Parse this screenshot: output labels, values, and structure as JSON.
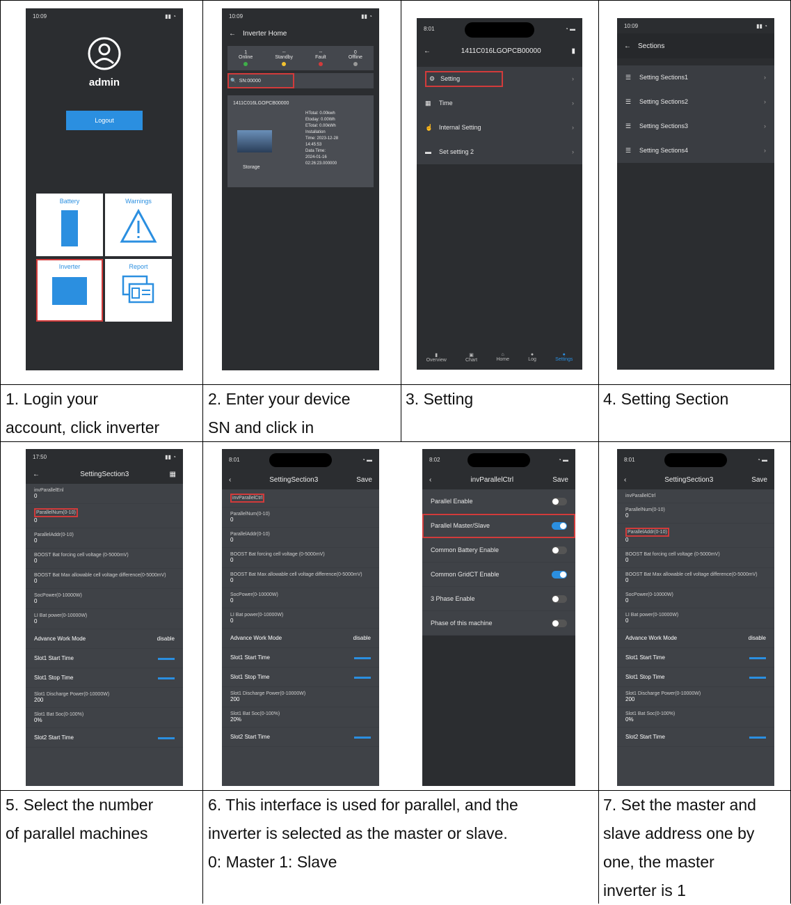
{
  "captions": {
    "c1": "1. Login your\naccount, click inverter",
    "c2": "2. Enter your device\nSN and click in",
    "c3": "3. Setting",
    "c4": "4. Setting Section",
    "c5": "5. Select the number\nof parallel machines",
    "c6": "6. This interface is used for parallel, and the\ninverter is selected as the master or slave.\n0: Master 1: Slave",
    "c7": "7. Set the master and\nslave address one by\none, the master\ninverter is 1"
  },
  "s1": {
    "status": "10:09",
    "user": "admin",
    "logout": "Logout",
    "tiles": [
      "Battery",
      "Warnings",
      "Inverter",
      "Report"
    ]
  },
  "s2": {
    "status": "10:09",
    "title": "Inverter Home",
    "counts": [
      {
        "label": "Online",
        "value": "1",
        "color": "#3fae49"
      },
      {
        "label": "Standby",
        "value": "--",
        "color": "#f2c230"
      },
      {
        "label": "Fault",
        "value": "--",
        "color": "#d23b3b"
      },
      {
        "label": "Offline",
        "value": "0",
        "color": "#999999"
      }
    ],
    "search": "SN:00000",
    "device_sn": "1411C016LGOPCB00000",
    "device_type": "Storage",
    "details": "HTotal: 0.00kwh\nEtoday: 0.00Wh\nETotal: 0.00kWh\nInstallation\nTime: 2023-12-28\n14:45:53\nData Time:\n2024-01-16\n02:26:23.000000"
  },
  "s3": {
    "status": "8:01",
    "title": "1411C016LGOPCB00000",
    "items": [
      "Setting",
      "Time",
      "Internal Setting",
      "Set setting 2"
    ],
    "tabs": [
      "Overview",
      "Chart",
      "Home",
      "Log",
      "Settings"
    ]
  },
  "s4": {
    "status": "10:09",
    "title": "Sections",
    "items": [
      "Setting Sections1",
      "Setting Sections2",
      "Setting Sections3",
      "Setting Sections4"
    ]
  },
  "s5": {
    "status": "17:50",
    "title": "SettingSection3",
    "fields": [
      {
        "k": "invParallelEnl",
        "v": "0"
      },
      {
        "k": "ParallelNum(0-10)",
        "v": "0"
      },
      {
        "k": "ParallelAddr(0-10)",
        "v": "0"
      },
      {
        "k": "BOOST Bat forcing cell voltage (0-5000mV)",
        "v": "0"
      },
      {
        "k": "BOOST Bat Max allowable cell voltage difference(0-5000mV)",
        "v": "0"
      },
      {
        "k": "SocPower(0-10000W)",
        "v": "0"
      },
      {
        "k": "LI Bat power(0-10000W)",
        "v": "0"
      },
      {
        "k": "Advance Work Mode",
        "v": "disable"
      },
      {
        "k": "Slot1 Start Time",
        "v": ""
      },
      {
        "k": "Slot1 Stop Time",
        "v": ""
      },
      {
        "k": "Slot1 Discharge Power(0-10000W)",
        "v": "200"
      },
      {
        "k": "Slot1 Bat Soc(0-100%)",
        "v": "0%"
      },
      {
        "k": "Slot2 Start Time",
        "v": ""
      }
    ]
  },
  "s6": {
    "status": "8:01",
    "title": "SettingSection3",
    "save": "Save",
    "fields": [
      {
        "k": "invParallelCtrl",
        "v": ""
      },
      {
        "k": "ParallelNum(0-10)",
        "v": "0"
      },
      {
        "k": "ParallelAddr(0-10)",
        "v": "0"
      },
      {
        "k": "BOOST Bat forcing cell voltage (0-5000mV)",
        "v": "0"
      },
      {
        "k": "BOOST Bat Max allowable cell voltage difference(0-5000mV)",
        "v": "0"
      },
      {
        "k": "SocPower(0-10000W)",
        "v": "0"
      },
      {
        "k": "LI Bat power(0-10000W)",
        "v": "0"
      },
      {
        "k": "Advance Work Mode",
        "v": "disable"
      },
      {
        "k": "Slot1 Start Time",
        "v": ""
      },
      {
        "k": "Slot1 Stop Time",
        "v": ""
      },
      {
        "k": "Slot1 Discharge Power(0-10000W)",
        "v": "200"
      },
      {
        "k": "Slot1 Bat Soc(0-100%)",
        "v": "20%"
      },
      {
        "k": "Slot2 Start Time",
        "v": ""
      }
    ]
  },
  "s6b": {
    "status": "8:02",
    "title": "invParallelCtrl",
    "save": "Save",
    "toggles": [
      {
        "label": "Parallel Enable",
        "on": false
      },
      {
        "label": "Parallel Master/Slave",
        "on": true
      },
      {
        "label": "Common Battery Enable",
        "on": false
      },
      {
        "label": "Common GridCT Enable",
        "on": true
      },
      {
        "label": "3 Phase Enable",
        "on": false
      },
      {
        "label": "Phase of this machine",
        "on": false
      }
    ]
  },
  "s7": {
    "status": "8:01",
    "title": "SettingSection3",
    "save": "Save",
    "fields": [
      {
        "k": "invParallelCtrl",
        "v": ""
      },
      {
        "k": "ParallelNum(0-10)",
        "v": "0"
      },
      {
        "k": "ParallelAddr(0-10)",
        "v": "0"
      },
      {
        "k": "BOOST Bat forcing cell voltage (0-5000mV)",
        "v": "0"
      },
      {
        "k": "BOOST Bat Max allowable cell voltage difference(0-5000mV)",
        "v": "0"
      },
      {
        "k": "SocPower(0-10000W)",
        "v": "0"
      },
      {
        "k": "LI Bat power(0-10000W)",
        "v": "0"
      },
      {
        "k": "Advance Work Mode",
        "v": "disable"
      },
      {
        "k": "Slot1 Start Time",
        "v": ""
      },
      {
        "k": "Slot1 Stop Time",
        "v": ""
      },
      {
        "k": "Slot1 Discharge Power(0-10000W)",
        "v": "200"
      },
      {
        "k": "Slot1 Bat Soc(0-100%)",
        "v": "0%"
      },
      {
        "k": "Slot2 Start Time",
        "v": ""
      }
    ]
  }
}
